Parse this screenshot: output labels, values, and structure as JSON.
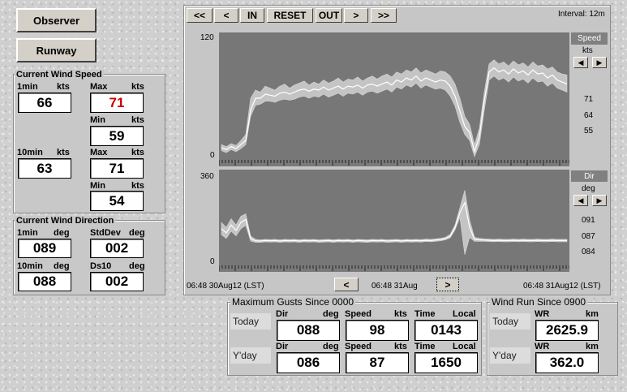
{
  "buttons": {
    "observer": "Observer",
    "runway": "Runway"
  },
  "wind_speed": {
    "title": "Current Wind Speed",
    "one_min": {
      "label": "1min",
      "unit": "kts",
      "value": "66"
    },
    "one_min_max": {
      "label": "Max",
      "unit": "kts",
      "value": "71"
    },
    "one_min_min": {
      "label": "Min",
      "unit": "kts",
      "value": "59"
    },
    "ten_min": {
      "label": "10min",
      "unit": "kts",
      "value": "63"
    },
    "ten_min_max": {
      "label": "Max",
      "unit": "kts",
      "value": "71"
    },
    "ten_min_min": {
      "label": "Min",
      "unit": "kts",
      "value": "54"
    },
    "max_color": "#cc0000"
  },
  "wind_direction": {
    "title": "Current Wind Direction",
    "one_min": {
      "label": "1min",
      "unit": "deg",
      "value": "089"
    },
    "stddev": {
      "label": "StdDev",
      "unit": "deg",
      "value": "002"
    },
    "ten_min": {
      "label": "10min",
      "unit": "deg",
      "value": "088"
    },
    "ds10": {
      "label": "Ds10",
      "unit": "deg",
      "value": "002"
    }
  },
  "chart_toolbar": {
    "first": "<<",
    "prev": "<",
    "zoom_in": "IN",
    "reset": "RESET",
    "zoom_out": "OUT",
    "next": ">",
    "last": ">>",
    "interval": "Interval: 12m"
  },
  "speed_panel": {
    "title": "Speed",
    "unit": "kts",
    "values": [
      "71",
      "64",
      "55"
    ],
    "ytick_top": "120",
    "ytick_bottom": "0"
  },
  "dir_panel": {
    "title": "Dir",
    "unit": "deg",
    "values": [
      "091",
      "087",
      "084"
    ],
    "ytick_top": "360",
    "ytick_bottom": "0"
  },
  "time_nav": {
    "start": "06:48 30Aug12 (LST)",
    "center": "06:48 31Aug",
    "end": "06:48 31Aug12 (LST)",
    "prev": "<",
    "next": ">"
  },
  "gusts": {
    "title": "Maximum Gusts Since 0000",
    "rows": [
      {
        "day": "Today",
        "dir_label": "Dir",
        "dir_unit": "deg",
        "dir": "088",
        "speed_label": "Speed",
        "speed_unit": "kts",
        "speed": "98",
        "time_label": "Time",
        "time_unit": "Local",
        "time": "0143"
      },
      {
        "day": "Y'day",
        "dir_label": "Dir",
        "dir_unit": "deg",
        "dir": "086",
        "speed_label": "Speed",
        "speed_unit": "kts",
        "speed": "87",
        "time_label": "Time",
        "time_unit": "Local",
        "time": "1650"
      }
    ]
  },
  "wind_run": {
    "title": "Wind Run Since 0900",
    "rows": [
      {
        "day": "Today",
        "label": "WR",
        "unit": "km",
        "value": "2625.9"
      },
      {
        "day": "Y'day",
        "label": "WR",
        "unit": "km",
        "value": "362.0"
      }
    ]
  },
  "chart_data": [
    {
      "type": "area",
      "title": "Speed",
      "ylabel": "kts",
      "ylim": [
        0,
        120
      ],
      "x": [
        0,
        6,
        12,
        18,
        24,
        30,
        36,
        42,
        48,
        54,
        60,
        66,
        72,
        78,
        84,
        90,
        96,
        102,
        108,
        114,
        120,
        126,
        132,
        138,
        144,
        150,
        156,
        162,
        168,
        174,
        180,
        186,
        192,
        198,
        204,
        210,
        216,
        222,
        228,
        234,
        240,
        246,
        252,
        258,
        264,
        270,
        276,
        282,
        288,
        294,
        300,
        306,
        312,
        318,
        324,
        330,
        336,
        342,
        348,
        354,
        360,
        366,
        372,
        378,
        384,
        390,
        396,
        402,
        408,
        414,
        420,
        426
      ],
      "series": [
        {
          "name": "max",
          "values": [
            12,
            10,
            13,
            11,
            16,
            22,
            58,
            66,
            64,
            70,
            68,
            66,
            70,
            72,
            68,
            71,
            73,
            75,
            71,
            74,
            72,
            76,
            73,
            75,
            78,
            74,
            77,
            76,
            79,
            75,
            78,
            80,
            77,
            80,
            82,
            79,
            84,
            82,
            86,
            84,
            88,
            83,
            86,
            84,
            82,
            85,
            84,
            80,
            72,
            58,
            40,
            32,
            12,
            28,
            64,
            92,
            96,
            92,
            94,
            90,
            95,
            91,
            93,
            89,
            94,
            90,
            91,
            87,
            89,
            84,
            82,
            81
          ]
        },
        {
          "name": "mean",
          "values": [
            9,
            7,
            10,
            8,
            12,
            16,
            46,
            58,
            58,
            62,
            61,
            60,
            63,
            64,
            62,
            64,
            66,
            67,
            65,
            67,
            66,
            69,
            66,
            68,
            70,
            67,
            70,
            69,
            71,
            68,
            71,
            72,
            70,
            72,
            74,
            71,
            76,
            74,
            78,
            76,
            80,
            75,
            78,
            76,
            74,
            76,
            75,
            70,
            60,
            45,
            30,
            24,
            5,
            20,
            55,
            84,
            88,
            84,
            86,
            82,
            87,
            83,
            85,
            81,
            86,
            82,
            83,
            78,
            81,
            76,
            74,
            72
          ]
        },
        {
          "name": "min",
          "values": [
            6,
            4,
            7,
            5,
            8,
            12,
            40,
            51,
            52,
            55,
            55,
            54,
            56,
            57,
            56,
            57,
            59,
            60,
            58,
            60,
            59,
            62,
            59,
            61,
            63,
            60,
            63,
            62,
            64,
            61,
            64,
            65,
            63,
            65,
            67,
            64,
            69,
            67,
            71,
            69,
            73,
            68,
            71,
            69,
            67,
            68,
            66,
            60,
            50,
            34,
            22,
            16,
            0,
            12,
            46,
            76,
            80,
            76,
            78,
            74,
            79,
            75,
            77,
            73,
            78,
            74,
            75,
            70,
            73,
            68,
            66,
            64
          ]
        }
      ]
    },
    {
      "type": "line",
      "title": "Dir",
      "ylabel": "deg",
      "ylim": [
        0,
        360
      ],
      "x": [
        0,
        6,
        12,
        18,
        24,
        30,
        36,
        42,
        48,
        54,
        60,
        66,
        72,
        78,
        84,
        90,
        96,
        102,
        108,
        114,
        120,
        126,
        132,
        138,
        144,
        150,
        156,
        162,
        168,
        174,
        180,
        186,
        192,
        198,
        204,
        210,
        216,
        222,
        228,
        234,
        240,
        246,
        252,
        258,
        264,
        270,
        276,
        282,
        288,
        294,
        300,
        306,
        312,
        318,
        324,
        330,
        336,
        342,
        348,
        354,
        360,
        366,
        372,
        378,
        384,
        390,
        396,
        402,
        408,
        414,
        420,
        426
      ],
      "series": [
        {
          "name": "max",
          "values": [
            160,
            140,
            175,
            150,
            185,
            195,
            105,
            92,
            90,
            92,
            91,
            92,
            90,
            92,
            91,
            92,
            90,
            92,
            91,
            92,
            90,
            91,
            92,
            90,
            92,
            91,
            92,
            90,
            92,
            91,
            90,
            92,
            91,
            92,
            90,
            91,
            92,
            90,
            92,
            91,
            92,
            91,
            93,
            92,
            94,
            96,
            100,
            112,
            150,
            220,
            290,
            170,
            100,
            96,
            94,
            93,
            92,
            93,
            92,
            92,
            93,
            92,
            93,
            92,
            92,
            93,
            92,
            92,
            93,
            92,
            92,
            92
          ]
        },
        {
          "name": "mean",
          "values": [
            135,
            118,
            150,
            128,
            160,
            172,
            95,
            86,
            85,
            87,
            86,
            87,
            85,
            87,
            86,
            87,
            85,
            87,
            86,
            87,
            85,
            86,
            87,
            85,
            87,
            86,
            87,
            85,
            87,
            86,
            85,
            87,
            86,
            87,
            85,
            86,
            87,
            85,
            87,
            86,
            87,
            86,
            88,
            87,
            89,
            91,
            95,
            105,
            140,
            200,
            240,
            140,
            92,
            90,
            89,
            88,
            87,
            88,
            87,
            87,
            88,
            87,
            88,
            87,
            87,
            88,
            87,
            87,
            88,
            87,
            87,
            87
          ]
        },
        {
          "name": "min",
          "values": [
            110,
            96,
            125,
            106,
            135,
            148,
            85,
            80,
            80,
            82,
            81,
            82,
            80,
            82,
            81,
            82,
            80,
            82,
            81,
            82,
            80,
            81,
            82,
            80,
            82,
            81,
            82,
            80,
            82,
            81,
            80,
            82,
            81,
            82,
            80,
            81,
            82,
            80,
            82,
            81,
            82,
            81,
            83,
            82,
            84,
            86,
            90,
            98,
            130,
            180,
            30,
            100,
            84,
            84,
            84,
            83,
            82,
            83,
            82,
            82,
            83,
            82,
            83,
            82,
            82,
            83,
            82,
            82,
            83,
            82,
            82,
            82
          ]
        }
      ]
    }
  ]
}
